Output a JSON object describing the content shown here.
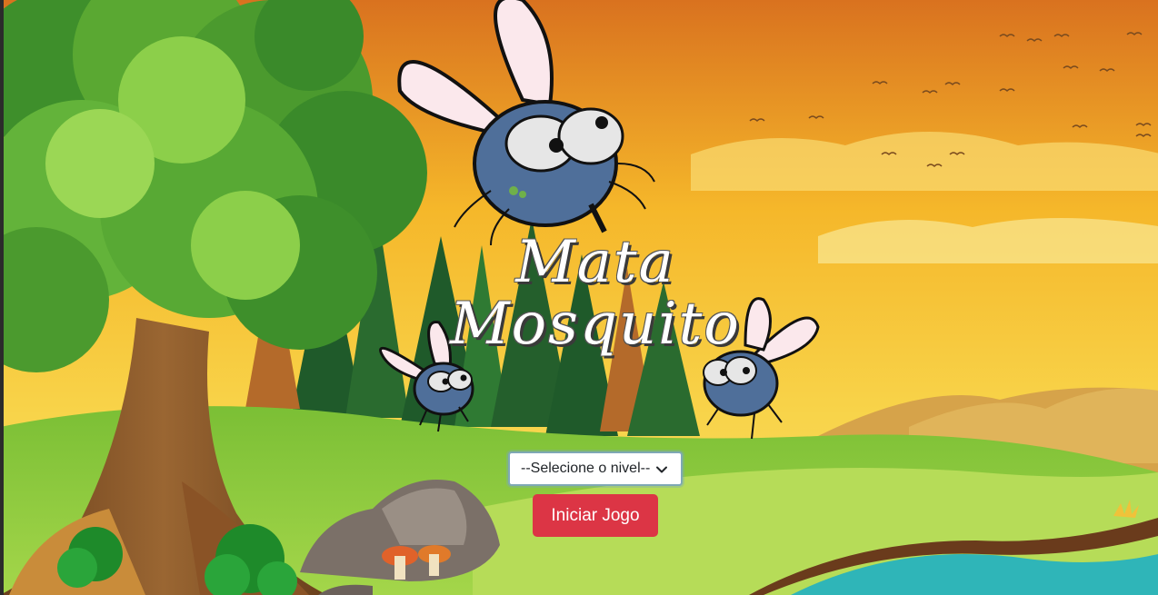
{
  "game": {
    "title_line1": "Mata",
    "title_line2": "Mosquito"
  },
  "level_select": {
    "selected": "--Selecione o nivel--"
  },
  "start_button": {
    "label": "Iniciar Jogo"
  },
  "colors": {
    "start_button": "#dc3545",
    "sky_top": "#e8862a",
    "sky_mid": "#f6c52a",
    "grass": "#8cc63f",
    "mosquito_body": "#4f6f9a"
  },
  "icons": {
    "select_arrow": "chevron-down-icon"
  }
}
